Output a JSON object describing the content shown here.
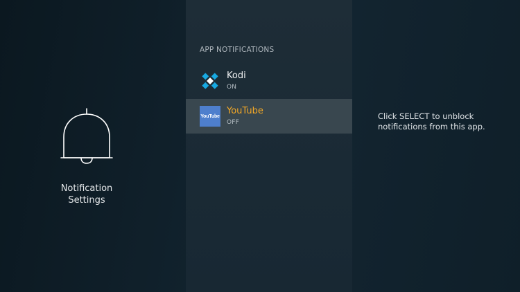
{
  "left": {
    "icon": "bell-icon",
    "title_line1": "Notification",
    "title_line2": "Settings"
  },
  "middle": {
    "header": "APP NOTIFICATIONS",
    "apps": [
      {
        "name": "Kodi",
        "status": "ON",
        "icon": "kodi-logo-icon"
      },
      {
        "name": "YouTube",
        "status": "OFF",
        "icon": "youtube-logo-icon",
        "icon_text": "YouTube",
        "selected": true
      }
    ]
  },
  "right": {
    "hint": "Click SELECT to unblock notifications from this app."
  },
  "colors": {
    "selected_text": "#f4a826",
    "selected_row": "#39474f",
    "kodi_blue": "#17a9e1",
    "youtube_tile": "#4e7fcd"
  }
}
